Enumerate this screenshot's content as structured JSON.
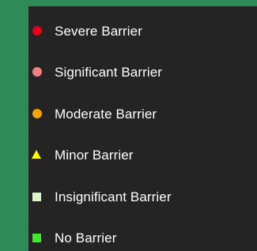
{
  "legend": {
    "items": [
      {
        "label": "Severe Barrier",
        "symbol": "circle",
        "color": "#e8001a",
        "icon": "red-circle-icon"
      },
      {
        "label": "Significant Barrier",
        "symbol": "circle",
        "color": "#f08080",
        "icon": "light-red-circle-icon"
      },
      {
        "label": "Moderate Barrier",
        "symbol": "circle",
        "color": "#f5a700",
        "icon": "orange-circle-icon"
      },
      {
        "label": "Minor Barrier",
        "symbol": "triangle",
        "color": "#ffff00",
        "icon": "yellow-triangle-icon"
      },
      {
        "label": "Insignificant Barrier",
        "symbol": "square",
        "color": "#d9f7c8",
        "icon": "pale-green-square-icon"
      },
      {
        "label": "No Barrier",
        "symbol": "square",
        "color": "#3ee82c",
        "icon": "green-square-icon"
      }
    ]
  },
  "colors": {
    "frame": "#2e8b57",
    "panel": "#242424",
    "text": "#ffffff"
  }
}
